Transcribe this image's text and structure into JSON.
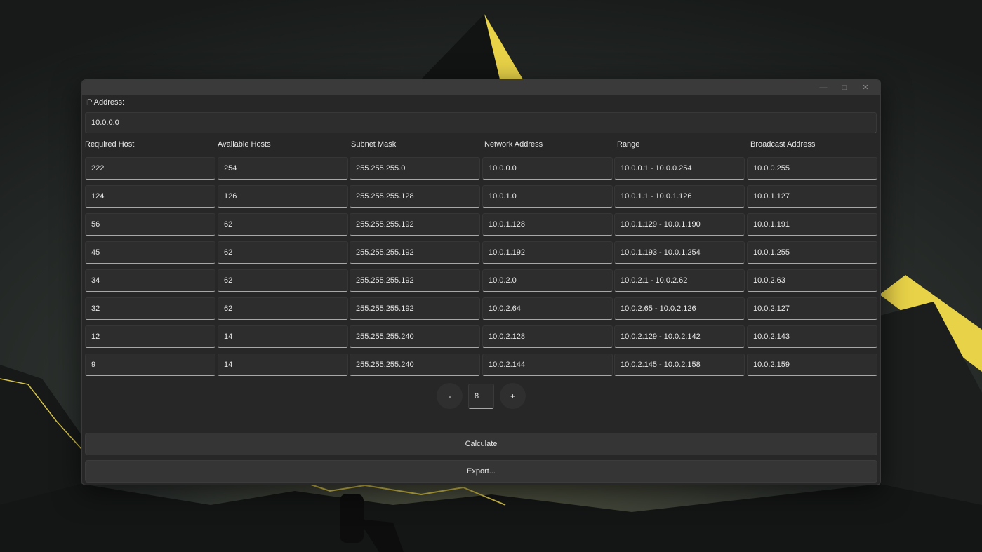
{
  "window": {
    "title": ""
  },
  "ip": {
    "label": "IP Address:",
    "value": "10.0.0.0"
  },
  "columns": [
    "Required Host",
    "Available Hosts",
    "Subnet Mask",
    "Network Address",
    "Range",
    "Broadcast Address"
  ],
  "rows": [
    [
      "222",
      "254",
      "255.255.255.0",
      "10.0.0.0",
      "10.0.0.1 - 10.0.0.254",
      "10.0.0.255"
    ],
    [
      "124",
      "126",
      "255.255.255.128",
      "10.0.1.0",
      "10.0.1.1 - 10.0.1.126",
      "10.0.1.127"
    ],
    [
      "56",
      "62",
      "255.255.255.192",
      "10.0.1.128",
      "10.0.1.129 - 10.0.1.190",
      "10.0.1.191"
    ],
    [
      "45",
      "62",
      "255.255.255.192",
      "10.0.1.192",
      "10.0.1.193 - 10.0.1.254",
      "10.0.1.255"
    ],
    [
      "34",
      "62",
      "255.255.255.192",
      "10.0.2.0",
      "10.0.2.1 - 10.0.2.62",
      "10.0.2.63"
    ],
    [
      "32",
      "62",
      "255.255.255.192",
      "10.0.2.64",
      "10.0.2.65 - 10.0.2.126",
      "10.0.2.127"
    ],
    [
      "12",
      "14",
      "255.255.255.240",
      "10.0.2.128",
      "10.0.2.129 - 10.0.2.142",
      "10.0.2.143"
    ],
    [
      "9",
      "14",
      "255.255.255.240",
      "10.0.2.144",
      "10.0.2.145 - 10.0.2.158",
      "10.0.2.159"
    ]
  ],
  "stepper": {
    "minus": "-",
    "value": "8",
    "plus": "+"
  },
  "buttons": {
    "calculate": "Calculate",
    "export": "Export..."
  },
  "icons": {
    "minimize": "minimize-icon",
    "maximize": "maximize-icon",
    "close": "close-icon"
  },
  "colors": {
    "accent": "#e0d24a",
    "window_bg": "#272727",
    "cell_bg": "#2d2d2d"
  }
}
